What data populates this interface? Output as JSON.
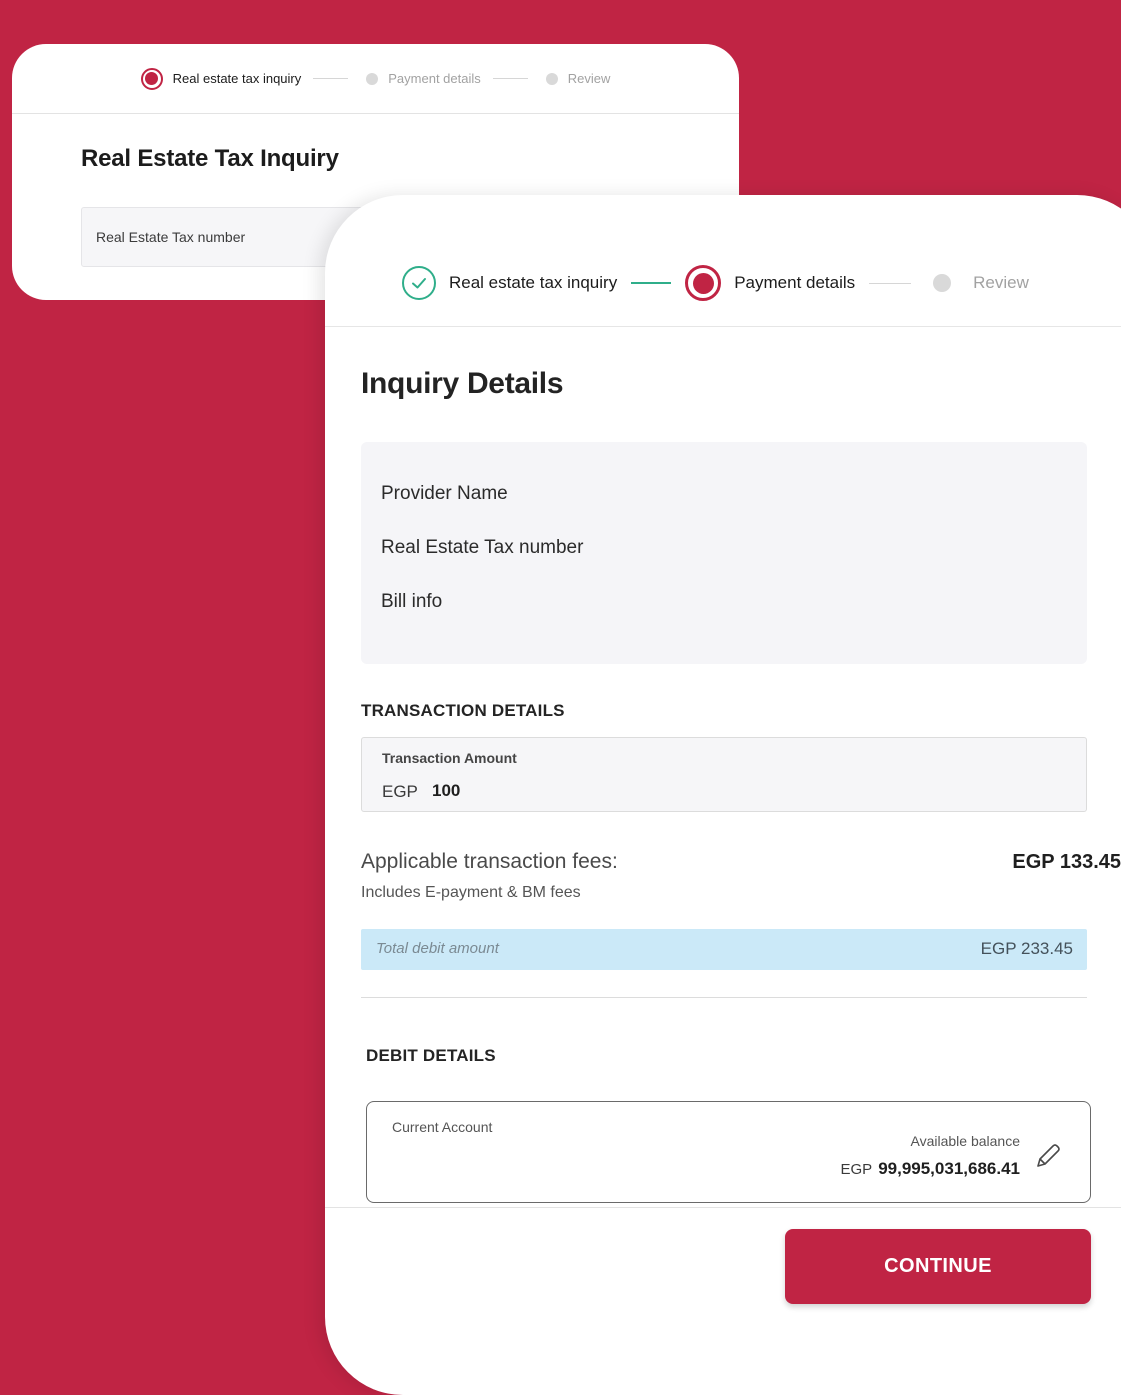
{
  "colors": {
    "brand_red": "#c02444",
    "success_green": "#2fae8a",
    "total_bar": "#cbe9f8"
  },
  "back_card": {
    "steps": [
      {
        "label": "Real estate tax inquiry",
        "state": "active"
      },
      {
        "label": "Payment details",
        "state": "pending"
      },
      {
        "label": "Review",
        "state": "pending"
      }
    ],
    "title": "Real Estate Tax Inquiry",
    "input_label": "Real Estate Tax number"
  },
  "front_card": {
    "steps": [
      {
        "label": "Real estate tax inquiry",
        "state": "completed",
        "icon": "check-icon"
      },
      {
        "label": "Payment details",
        "state": "active"
      },
      {
        "label": "Review",
        "state": "pending"
      }
    ],
    "title": "Inquiry Details",
    "info_rows": [
      "Provider Name",
      "Real Estate Tax number",
      "Bill info"
    ],
    "transaction": {
      "section_title": "TRANSACTION DETAILS",
      "amount_label": "Transaction Amount",
      "currency": "EGP",
      "amount": "100"
    },
    "fees": {
      "label": "Applicable transaction fees:",
      "value": "EGP 133.45",
      "note": "Includes E-payment & BM fees"
    },
    "total": {
      "label": "Total debit amount",
      "value": "EGP 233.45"
    },
    "debit": {
      "section_title": "DEBIT DETAILS",
      "account_type": "Current Account",
      "available_label": "Available balance",
      "currency": "EGP",
      "balance": "99,995,031,686.41",
      "edit_icon": "pencil-icon"
    },
    "continue_label": "CONTINUE"
  }
}
